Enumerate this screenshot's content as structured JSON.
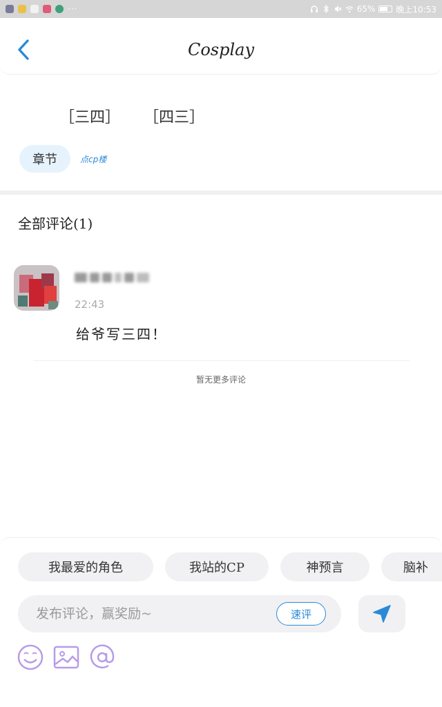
{
  "status_bar": {
    "more": "···",
    "battery": "65%",
    "time": "晚上10:53",
    "app_colors": [
      "#7a7a9a",
      "#e8c14a",
      "#f2f2f2",
      "#e05a7a",
      "#3fa07a"
    ]
  },
  "header": {
    "title": "Cosplay",
    "back_icon": "chevron-left-icon"
  },
  "chapter": {
    "pairing_1": "［三四］",
    "pairing_2": "［四三］",
    "chapter_button": "章节",
    "cp_link": "点cp楼"
  },
  "comments": {
    "header": "全部评论(1)",
    "items": [
      {
        "username": "",
        "time": "22:43",
        "text": "给爷写三四！"
      }
    ],
    "no_more": "暂无更多评论"
  },
  "quick_tags": [
    "我最爱的角色",
    "我站的CP",
    "神预言",
    "脑补"
  ],
  "composer": {
    "placeholder": "发布评论，赢奖励~",
    "quick_button": "速评",
    "send_icon": "send-arrow-icon",
    "tools": [
      "smiley-icon",
      "image-icon",
      "at-icon"
    ]
  },
  "colors": {
    "accent": "#2a8ad8",
    "chip_bg": "#f1f1f3",
    "tool_purple": "#b89be8"
  }
}
